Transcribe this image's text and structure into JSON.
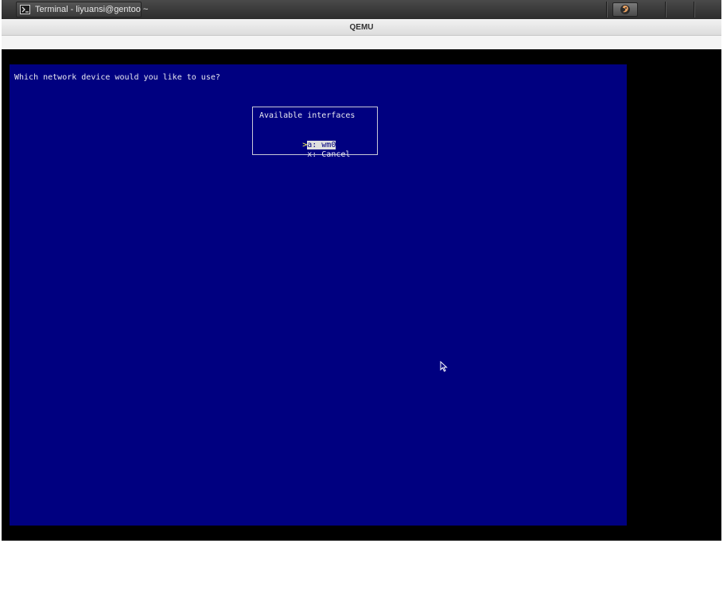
{
  "taskbar": {
    "window_button_label": "Terminal - liyuansi@gentoo ~",
    "window_icon": "terminal-icon",
    "tray_icon": "gentoo-logo-icon"
  },
  "qemu_window": {
    "title": "QEMU"
  },
  "guest": {
    "prompt": "Which network device would you like to use?",
    "dialog": {
      "title": "Available interfaces",
      "options": [
        {
          "marker": ">",
          "key": "a",
          "label": "a: wm0",
          "selected": true
        },
        {
          "marker": " ",
          "key": "x",
          "label": "x: Cancel",
          "selected": false
        }
      ]
    }
  },
  "colors": {
    "guest_background": "#000080",
    "guest_text": "#e8e8f0",
    "selected_marker": "#ffff55",
    "display_background": "#000000"
  }
}
